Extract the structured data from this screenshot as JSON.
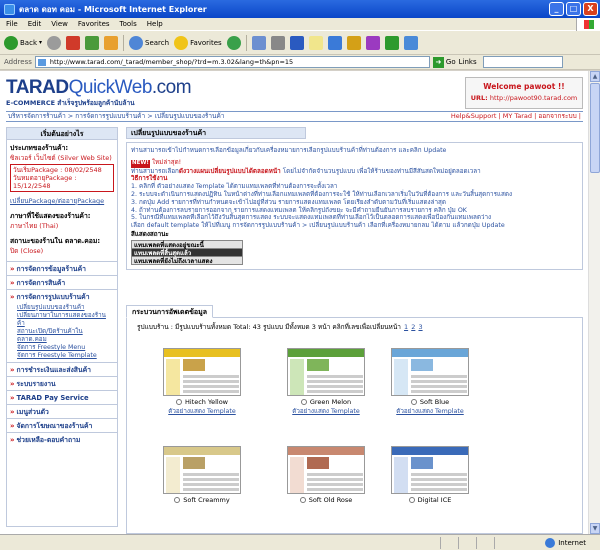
{
  "window": {
    "title": "ตลาด ดอท คอม - Microsoft Internet Explorer",
    "controls": [
      "_",
      "□",
      "X"
    ]
  },
  "menubar": [
    "File",
    "Edit",
    "View",
    "Favorites",
    "Tools",
    "Help"
  ],
  "toolbar": {
    "back": "Back",
    "search": "Search",
    "favorites": "Favorites"
  },
  "address": {
    "label": "Address",
    "url": "http://www.tarad.com/_tarad/member_shop/?trd=m.3.02&lang=th&pn=15",
    "go": "Go",
    "links": "Links"
  },
  "status": {
    "zone": "Internet"
  },
  "header": {
    "brand_a": "TARAD",
    "brand_b": "QuickWeb",
    "brand_c": ".com",
    "tagline": "E-COMMERCE สำเร็จรูปพร้อมลูกค้านับล้าน",
    "welcome": "Welcome pawoot !!",
    "url_label": "URL:",
    "url_value": "http://pawoot90.tarad.com"
  },
  "breadcrumb": {
    "path": "บริหารจัดการร้านค้า > การจัดการรูปแบบร้านค้า > เปลี่ยนรูปแบบของร้านค้า",
    "right": "Help&Support | MY Tarad | ออกจากระบบ |"
  },
  "sidebar": {
    "head": "เริ่มต้นอย่างไร",
    "type_title": "ประเภทของร้านค้า:",
    "type_value": "ซิลเวอร์ เว็บไซต์ (Silver Web Site)",
    "package_start": "วันเริ่มPackage : 08/02/2548",
    "package_end": "วันหมดอายุPackage : 15/12/2548",
    "package_link": "เปลี่ยนPackage/ต่ออายุPackage",
    "lang_title": "ภาษาที่ใช้แสดงของร้านค้า:",
    "lang_value": "ภาษาไทย (Thai)",
    "status_title": "สถานะของร้านใน ตลาด.คอม:",
    "status_value": "ปิด (Close)",
    "menu": [
      "การจัดการข้อมูลร้านค้า",
      "การจัดการสินค้า",
      "การจัดการรูปแบบร้านค้า"
    ],
    "submenu": [
      "เปลี่ยนรูปแบบของร้านค้า",
      "เปลี่ยนภาษาในการแสดงของร้านค้า",
      "สถานะเปิด/ปิดร้านค้าใน ตลาด.คอม",
      "จัดการ Freestyle Menu",
      "จัดการ Freestyle Template"
    ],
    "menu2": [
      "การชำระเงินและส่งสินค้า",
      "ระบบรายงาน",
      "TARAD Pay Service",
      "เมนูส่วนตัว",
      "จัดการโฆษณาของร้านค้า",
      "ช่วยเหลือ-ตอบคำถาม"
    ]
  },
  "main": {
    "title": "เปลี่ยนรูปแบบของร้านค้า",
    "intro": "ท่านสามารถเข้าไปกำหนดการเลือกข้อมูลเกี่ยวกับเครื่องหมายการเลือกรูปแบบร้านค้าที่ท่านต้องการ และคลิก Update",
    "new_badge": "NEW!",
    "new_text": "ใหม่ล่าสุด!",
    "new_desc": "ท่านสามารถเลือก",
    "new_desc_bold": "ดังวางแผนเปลี่ยนรูปแบบได้ตลอดหน้า",
    "new_desc_tail": " โดยไม่จำกัดจำนวนรูปแบบ เพื่อให้ร้านของท่านมีสีสันสดใหม่อยู่ตลอดเวลา",
    "howto": "วิธีการใช้งาน",
    "steps": [
      "1. คลิกที่ ตัวอย่างแสดง Template ได้ตามแทมเพลตที่ท่านต้องการจะตั้งเวลา",
      "2. ระบบจะดำเนินการแสดงปฏิทิน ในหน้าต่างที่ท่านเลือกแทมเพลตที่ต้องการจะใช้ ให้ท่านเลือกเวลาเริ่มในวันที่ต้องการ และวันสิ้นสุดการแสดง",
      "3. กดปุ่ม Add รายการที่ท่านกำหนดจะเข้าไปอยู่ที่ส่วน รายการแสดงแทมเพลต โดยเรียงลำดับตามวันที่เริ่มแสดงล่าสุด",
      "4. ถ้าท่านต้องการลบรายการออกจาก รายการแสดงแทมเพลต ให้คลิกรูปถังขยะ จะมีคำถามยืนยันการลบรายการ คลิก ปุ่ม OK",
      "5. ในกรณีที่แทมเพลตที่เลือกไว้ถึงวันสิ้นสุดการแสดง ระบบจะแสดงแทมเพลตที่ท่านเลือกไว้เป็นตลอดการแสดงเพื่อป้องกันแทมเพลตว่าง",
      "เลือก default template ให้ไปที่เมนู การจัดการรูปแบบร้านค้า > เปลี่ยนรูปแบบร้านค้า เลือกที่เครื่องหมายกลม ได้ตาม แล้วกดปุ่ม Update"
    ],
    "status_title": "สีแสดงสถานะ",
    "status_items": [
      "แทมเพลตที่แสดงอยู่ขณะนี้",
      "แทมเพลตที่สิ้นสุดแล้ว",
      "แทมเพลตที่ยังไม่ถึงเวลาแสดง"
    ],
    "tab": "กระบวนการอัพเดตข้อมูล",
    "gallery_info": "รูปแบบร้าน : มีรูปแบบร้านทั้งหมด Total: 43 รูปแบบ มีทั้งหมด 3 หน้า คลิกที่เลขเพื่อเปลี่ยนหน้า",
    "pages": [
      "1",
      "2",
      "3"
    ],
    "example_label": "ตัวอย่างแสดง Template",
    "templates": [
      {
        "name": "Hitech Yellow",
        "band": "#e8c020",
        "side": "#f5e7a0",
        "pic": "#c9a24a"
      },
      {
        "name": "Green Melon",
        "band": "#5ca03a",
        "side": "#cde6b8",
        "pic": "#7fb55a"
      },
      {
        "name": "Soft Blue",
        "band": "#6aa6d8",
        "side": "#d6e7f5",
        "pic": "#8ab8e0"
      },
      {
        "name": "Soft Creammy",
        "band": "#d8c88a",
        "side": "#f3ecd0",
        "pic": "#b9a066"
      },
      {
        "name": "Soft Old Rose",
        "band": "#c88870",
        "side": "#f2dcd2",
        "pic": "#b06a52"
      },
      {
        "name": "Digital ICE",
        "band": "#3a6ab8",
        "side": "#d2def2",
        "pic": "#6a92cc"
      }
    ]
  }
}
